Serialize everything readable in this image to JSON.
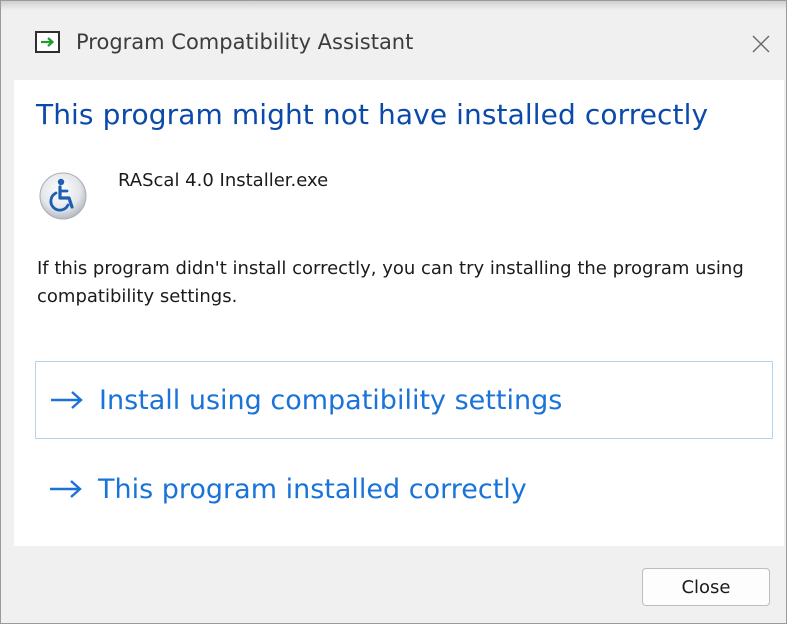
{
  "window": {
    "title": "Program Compatibility Assistant",
    "close_icon": "close-icon"
  },
  "main": {
    "headline": "This program might not have installed correctly",
    "program_name": "RAScal 4.0 Installer.exe",
    "program_icon": "accessibility-icon",
    "description": "If this program didn't install correctly, you can try installing the program using compatibility settings."
  },
  "options": [
    {
      "label": "Install using compatibility settings",
      "icon": "arrow-right-icon",
      "highlighted": true
    },
    {
      "label": "This program installed correctly",
      "icon": "arrow-right-icon",
      "highlighted": false
    }
  ],
  "footer": {
    "close_label": "Close"
  },
  "colors": {
    "headline": "#0b4aaa",
    "link": "#1a73d9",
    "highlight_border": "#b4d3ee",
    "background": "#f0f0f0",
    "content": "#ffffff"
  }
}
